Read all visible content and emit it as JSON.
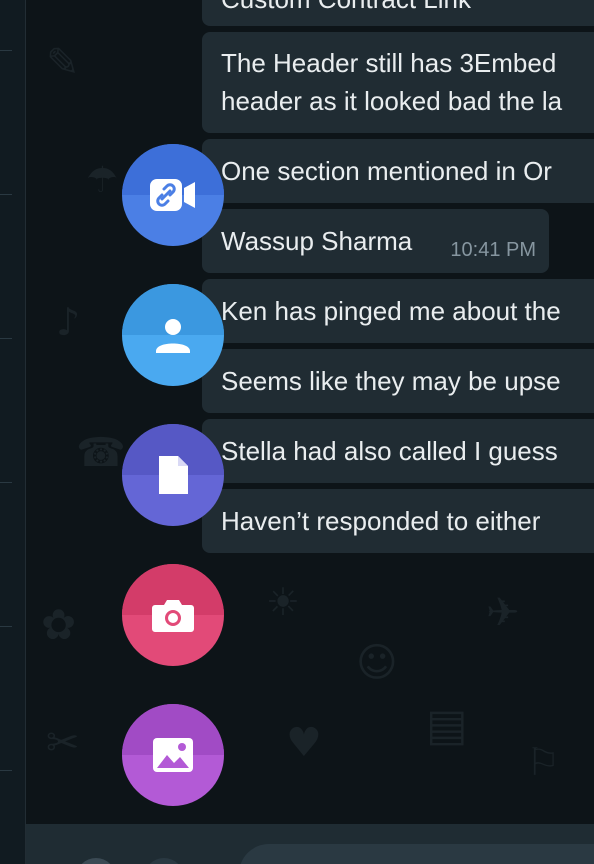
{
  "messages": [
    {
      "lines": [
        "Custom Contract Link"
      ],
      "time": ""
    },
    {
      "lines": [
        "The Header still has 3Embed",
        "header as it looked bad the la"
      ],
      "time": ""
    },
    {
      "lines": [
        "One section mentioned in Or"
      ],
      "time": ""
    },
    {
      "lines": [
        "Wassup Sharma"
      ],
      "time": "10:41 PM"
    },
    {
      "lines": [
        "Ken has pinged me about the"
      ],
      "time": ""
    },
    {
      "lines": [
        "Seems like they may be upse"
      ],
      "time": ""
    },
    {
      "lines": [
        "Stella had also called I guess"
      ],
      "time": ""
    },
    {
      "lines": [
        "Haven’t responded to either"
      ],
      "time": ""
    }
  ],
  "attach_menu": [
    {
      "name": "room",
      "icon": "video-link-icon",
      "color": "#4b7fe5",
      "color_top": "#3d6fd9"
    },
    {
      "name": "contact",
      "icon": "person-icon",
      "color": "#4aa9f0",
      "color_top": "#3b98e0"
    },
    {
      "name": "document",
      "icon": "document-icon",
      "color": "#6466d6",
      "color_top": "#5658c5"
    },
    {
      "name": "camera",
      "icon": "camera-icon",
      "color": "#e24a78",
      "color_top": "#d33c69"
    },
    {
      "name": "photos-videos",
      "icon": "image-icon",
      "color": "#b35ad6",
      "color_top": "#a14bc5"
    }
  ]
}
